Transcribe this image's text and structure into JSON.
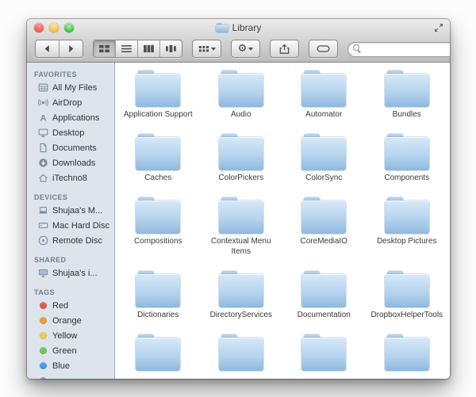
{
  "window": {
    "title": "Library"
  },
  "toolbar": {
    "search": {
      "placeholder": "",
      "value": ""
    },
    "buttons": [
      "back",
      "forward",
      "icon-view",
      "list-view",
      "column-view",
      "coverflow-view",
      "arrange",
      "action",
      "share",
      "tags"
    ],
    "selected_view": "icon-view"
  },
  "sidebar": {
    "sections": [
      {
        "title": "FAVORITES",
        "items": [
          {
            "label": "All My Files",
            "icon": "all-my-files"
          },
          {
            "label": "AirDrop",
            "icon": "airdrop"
          },
          {
            "label": "Applications",
            "icon": "applications"
          },
          {
            "label": "Desktop",
            "icon": "desktop"
          },
          {
            "label": "Documents",
            "icon": "documents"
          },
          {
            "label": "Downloads",
            "icon": "downloads"
          },
          {
            "label": "iTechno8",
            "icon": "home"
          }
        ]
      },
      {
        "title": "DEVICES",
        "items": [
          {
            "label": "Shujaa's M...",
            "icon": "laptop"
          },
          {
            "label": "Mac Hard Disc",
            "icon": "internal-disk"
          },
          {
            "label": "Remote Disc",
            "icon": "disc"
          }
        ]
      },
      {
        "title": "SHARED",
        "items": [
          {
            "label": "Shujaa's i...",
            "icon": "shared-computer"
          }
        ]
      },
      {
        "title": "TAGS",
        "items": [
          {
            "label": "Red",
            "tag_color": "#df5b51"
          },
          {
            "label": "Orange",
            "tag_color": "#f1983c"
          },
          {
            "label": "Yellow",
            "tag_color": "#f6c94e"
          },
          {
            "label": "Green",
            "tag_color": "#74c454"
          },
          {
            "label": "Blue",
            "tag_color": "#3f9ef4"
          },
          {
            "label": "",
            "tag_color": "#9a6fc9",
            "partial": true
          }
        ]
      }
    ]
  },
  "content": {
    "folders": [
      "Application Support",
      "Audio",
      "Automator",
      "Bundles",
      "Caches",
      "ColorPickers",
      "ColorSync",
      "Components",
      "Compositions",
      "Contextual Menu Items",
      "CoreMediaIO",
      "Desktop Pictures",
      "Dictionaries",
      "DirectoryServices",
      "Documentation",
      "DropboxHelperTools"
    ],
    "partially_visible_folders": 4
  },
  "colors": {
    "folder_blue_top": "#d7e9f8",
    "folder_blue_bottom": "#8fb9de",
    "sidebar_background": "#dde4ec",
    "chrome_top": "#ececec",
    "chrome_bottom": "#bcbcbc",
    "traffic_red": "#f95c52",
    "traffic_yellow": "#fdbf45",
    "traffic_green": "#3dcc47"
  }
}
